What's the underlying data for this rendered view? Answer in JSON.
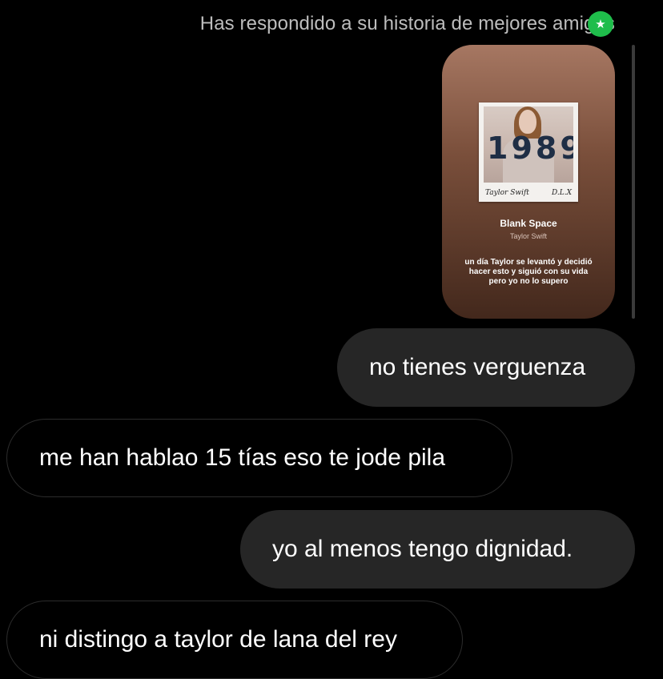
{
  "header": {
    "reply_text": "Has respondido a su historia de mejores amigos",
    "badge_icon": "star-icon",
    "badge_color": "#1fbd4b"
  },
  "story": {
    "album_number": "1989",
    "album_artist_signature": "Taylor Swift",
    "album_edition": "D.L.X",
    "track_title": "Blank Space",
    "track_artist": "Taylor Swift",
    "caption": "un día Taylor se levantó y decidió hacer esto y siguió con su vida pero yo no lo supero"
  },
  "messages": [
    {
      "direction": "sent",
      "text": "no tienes verguenza"
    },
    {
      "direction": "received",
      "text": "me han hablao 15 tías eso te jode pila"
    },
    {
      "direction": "sent",
      "text": "yo al menos tengo dignidad."
    },
    {
      "direction": "received",
      "text": "ni distingo a taylor de lana del rey"
    }
  ],
  "colors": {
    "background": "#000000",
    "sent_bubble": "#262626",
    "received_border": "#2c2c2c"
  }
}
